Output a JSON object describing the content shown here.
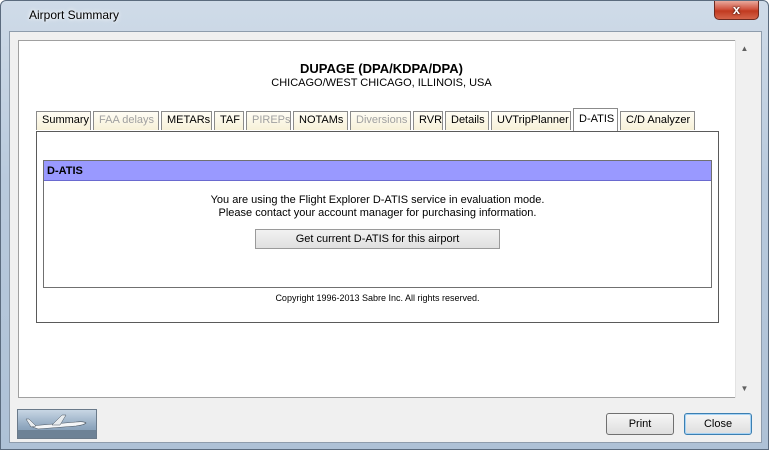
{
  "window": {
    "title": "Airport Summary",
    "close_glyph": "x"
  },
  "airport": {
    "name": "DUPAGE (DPA/KDPA/DPA)",
    "location": "CHICAGO/WEST CHICAGO, ILLINOIS, USA"
  },
  "tabs": [
    {
      "label": "Summary",
      "state": "enabled"
    },
    {
      "label": "FAA delays",
      "state": "disabled"
    },
    {
      "label": "METARs",
      "state": "enabled"
    },
    {
      "label": "TAF",
      "state": "enabled"
    },
    {
      "label": "PIREPs",
      "state": "disabled"
    },
    {
      "label": "NOTAMs",
      "state": "enabled"
    },
    {
      "label": "Diversions",
      "state": "disabled"
    },
    {
      "label": "RVR",
      "state": "enabled"
    },
    {
      "label": "Details",
      "state": "enabled"
    },
    {
      "label": "UVTripPlanner",
      "state": "enabled"
    },
    {
      "label": "D-ATIS",
      "state": "active"
    },
    {
      "label": "C/D Analyzer",
      "state": "enabled"
    }
  ],
  "datis": {
    "header": "D-ATIS",
    "message_line1": "You are using the Flight Explorer D-ATIS service in evaluation mode.",
    "message_line2": "Please contact your account manager for purchasing information.",
    "button_label": "Get current D-ATIS for this airport"
  },
  "copyright": "Copyright 1996-2013 Sabre Inc. All rights reserved.",
  "footer": {
    "print_label": "Print",
    "close_label": "Close",
    "logo_icon": "airplane-logo-icon"
  },
  "colors": {
    "datis_header_bg": "#9999ff",
    "tab_bg": "#f7f1d8"
  }
}
